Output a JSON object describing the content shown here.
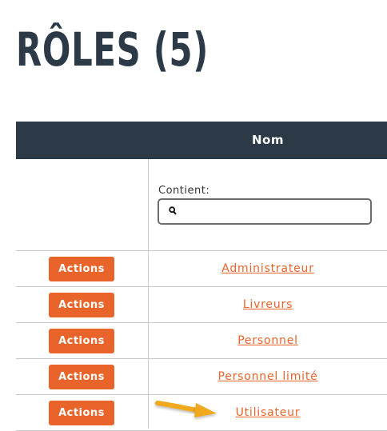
{
  "page": {
    "title": "RÔLES (5)"
  },
  "table": {
    "column_header": "Nom",
    "filter": {
      "label": "Contient:",
      "value": "",
      "placeholder": ""
    },
    "rows": [
      {
        "action_label": "Actions",
        "role": "Administrateur"
      },
      {
        "action_label": "Actions",
        "role": "Livreurs"
      },
      {
        "action_label": "Actions",
        "role": "Personnel"
      },
      {
        "action_label": "Actions",
        "role": "Personnel limité"
      },
      {
        "action_label": "Actions",
        "role": "Utilisateur"
      }
    ]
  },
  "icons": {
    "search": "search-icon",
    "pointer": "arrow-right-icon"
  },
  "colors": {
    "header_bg": "#2c3a48",
    "accent": "#e8642a",
    "arrow": "#f0a81e"
  }
}
